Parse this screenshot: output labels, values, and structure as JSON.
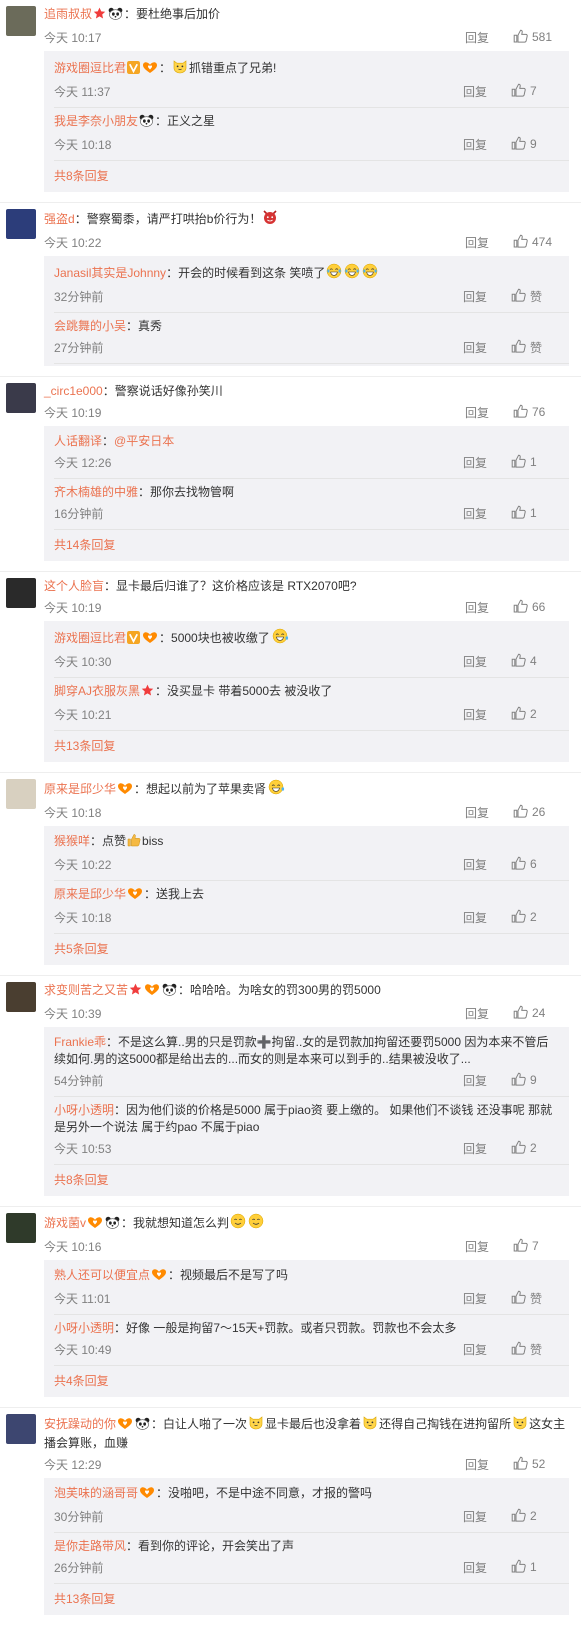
{
  "labels": {
    "reply": "回复",
    "like_zero": "赞"
  },
  "colors": {
    "username": "#eb7350",
    "meta": "#808080",
    "reply_bg": "#f2f2f5"
  },
  "comments": [
    {
      "user": "追雨叔叔",
      "badges": [
        "star-icon",
        "panda-icon"
      ],
      "text": "要杜绝事后加价",
      "time": "今天 10:17",
      "likes": "581",
      "avatar_color": "#6b6b5a",
      "replies": [
        {
          "user": "游戏圈逗比君",
          "badges": [
            "verified-v-icon",
            "fan-badge-icon"
          ],
          "text": "抓错重点了兄弟!",
          "emojis": [
            "cat-face-emoji"
          ],
          "time": "今天 11:37",
          "likes": "7"
        },
        {
          "user": "我是李奈小朋友",
          "badges": [
            "panda-icon"
          ],
          "text": "正义之星",
          "time": "今天 10:18",
          "likes": "9"
        }
      ],
      "more": "共8条回复"
    },
    {
      "user": "强盗d",
      "badges": [],
      "text": "警察蜀黍，请严打哄抬b价行为！",
      "emojis_after": [
        "devil-emoji"
      ],
      "time": "今天 10:22",
      "likes": "474",
      "avatar_color": "#2c3d7a",
      "replies": [
        {
          "user": "Janasil其实是Johnny",
          "badges": [],
          "text": "开会的时候看到这条 笑喷了",
          "emojis_after": [
            "laugh-cry-emoji",
            "laugh-cry-emoji",
            "laugh-cry-emoji"
          ],
          "time": "32分钟前",
          "likes": "赞"
        },
        {
          "user": "会跳舞的小吴",
          "badges": [],
          "text": "真秀",
          "time": "27分钟前",
          "likes": "赞"
        }
      ],
      "more": ""
    },
    {
      "user": "_circ1e000",
      "badges": [],
      "text": "警察说话好像孙笑川",
      "time": "今天 10:19",
      "likes": "76",
      "avatar_color": "#3a3a4a",
      "replies": [
        {
          "user": "人话翻译",
          "badges": [],
          "text": "@平安日本",
          "mention": true,
          "time": "今天 12:26",
          "likes": "1"
        },
        {
          "user": "齐木楠雄的中雅",
          "badges": [],
          "text": "那你去找物管啊",
          "time": "16分钟前",
          "likes": "1"
        }
      ],
      "more": "共14条回复"
    },
    {
      "user": "这个人脸盲",
      "badges": [],
      "text": "显卡最后归谁了？这价格应该是 RTX2070吧?",
      "time": "今天 10:19",
      "likes": "66",
      "avatar_color": "#2a2a2a",
      "replies": [
        {
          "user": "游戏圈逗比君",
          "badges": [
            "verified-v-icon",
            "fan-badge-icon"
          ],
          "text": "5000块也被收缴了",
          "emojis_after": [
            "laugh-emoji"
          ],
          "time": "今天 10:30",
          "likes": "4"
        },
        {
          "user": "脚穿AJ衣服灰黑",
          "badges": [
            "star-icon"
          ],
          "text": "没买显卡 带着5000去 被没收了",
          "time": "今天 10:21",
          "likes": "2"
        }
      ],
      "more": "共13条回复"
    },
    {
      "user": "原来是邱少华",
      "badges": [
        "fan-badge-icon"
      ],
      "text": "想起以前为了苹果卖肾",
      "emojis_after": [
        "laugh-emoji"
      ],
      "time": "今天 10:18",
      "likes": "26",
      "avatar_color": "#d8d0c0",
      "replies": [
        {
          "user": "猴猴咩",
          "badges": [],
          "text": "点赞",
          "emojis_after": [
            "thumbs-up-emoji"
          ],
          "text_after": "biss",
          "time": "今天 10:22",
          "likes": "6"
        },
        {
          "user": "原来是邱少华",
          "badges": [
            "fan-badge-icon"
          ],
          "text": "送我上去",
          "time": "今天 10:18",
          "likes": "2"
        }
      ],
      "more": "共5条回复"
    },
    {
      "user": "求变则苦之又苦",
      "badges": [
        "star-icon",
        "fan-badge-icon",
        "panda-icon"
      ],
      "text": "哈哈哈。为啥女的罚300男的罚5000",
      "time": "今天 10:39",
      "likes": "24",
      "avatar_color": "#4a3e30",
      "replies": [
        {
          "user": "Frankie乖",
          "badges": [],
          "text": "不是这么算..男的只是罚款➕拘留..女的是罚款加拘留还要罚5000 因为本来不管后续如何.男的这5000都是给出去的...而女的则是本来可以到手的..结果被没收了...",
          "time": "54分钟前",
          "likes": "9"
        },
        {
          "user": "小呀小透明",
          "badges": [],
          "text": "因为他们谈的价格是5000 属于piao资 要上缴的。 如果他们不谈钱 还没事呢 那就是另外一个说法 属于约pao 不属于piao",
          "time": "今天 10:53",
          "likes": "2"
        }
      ],
      "more": "共8条回复"
    },
    {
      "user": "游戏菌v",
      "badges": [
        "fan-badge-icon",
        "panda-icon"
      ],
      "text": "我就想知道怎么判",
      "emojis_after": [
        "smile-emoji",
        "smile-emoji"
      ],
      "time": "今天 10:16",
      "likes": "7",
      "avatar_color": "#2f3a2a",
      "replies": [
        {
          "user": "熟人还可以便宜点",
          "badges": [
            "fan-badge-icon"
          ],
          "text": "视频最后不是写了吗",
          "time": "今天 11:01",
          "likes": "赞"
        },
        {
          "user": "小呀小透明",
          "badges": [],
          "text": "好像 一般是拘留7～15天+罚款。或者只罚款。罚款也不会太多",
          "time": "今天 10:49",
          "likes": "赞"
        }
      ],
      "more": "共4条回复"
    },
    {
      "user": "安抚躁动的你",
      "badges": [
        "fan-badge-icon",
        "panda-icon"
      ],
      "text": "白让人啪了一次",
      "segments": [
        {
          "emoji": "cat-face-emoji",
          "text": "显卡最后也没拿着"
        },
        {
          "emoji": "cat-face-emoji",
          "text": "还得自己掏钱在进拘留所"
        },
        {
          "emoji": "cat-face-emoji",
          "text": "这女主播会算账，血赚"
        }
      ],
      "time": "今天 12:29",
      "likes": "52",
      "avatar_color": "#3d4670",
      "replies": [
        {
          "user": "泡芙味的涵哥哥",
          "badges": [
            "fan-badge-icon"
          ],
          "text": "没啪吧，不是中途不同意，才报的警吗",
          "time": "30分钟前",
          "likes": "2"
        },
        {
          "user": "是你走路带风",
          "badges": [],
          "text": "看到你的评论，开会笑出了声",
          "time": "26分钟前",
          "likes": "1"
        }
      ],
      "more": "共13条回复"
    }
  ]
}
